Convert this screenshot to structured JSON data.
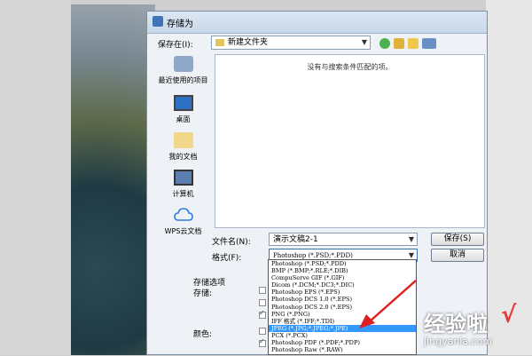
{
  "dialog": {
    "title": "存储为",
    "save_in_label": "保存在(I):",
    "current_folder": "新建文件夹",
    "empty_message": "没有与搜索条件匹配的项。"
  },
  "places": [
    {
      "label": "最近使用的项目",
      "icon": "recent-items-icon"
    },
    {
      "label": "桌面",
      "icon": "desktop-icon"
    },
    {
      "label": "我的文档",
      "icon": "documents-icon"
    },
    {
      "label": "计算机",
      "icon": "computer-icon"
    },
    {
      "label": "WPS云文档",
      "icon": "cloud-icon"
    }
  ],
  "filename": {
    "label": "文件名(N):",
    "value": "演示文稿2-1"
  },
  "format": {
    "label": "格式(F):",
    "value": "Photoshop (*.PSD;*.PDD)",
    "options": [
      "Photoshop (*.PSD;*.PDD)",
      "BMP (*.BMP;*.RLE;*.DIB)",
      "CompuServe GIF (*.GIF)",
      "Dicom (*.DCM;*.DC3;*.DIC)",
      "Photoshop EPS (*.EPS)",
      "Photoshop DCS 1.0 (*.EPS)",
      "Photoshop DCS 2.0 (*.EPS)",
      "PNG (*.PNG)",
      "IFF 格式 (*.IFF;*.TDI)",
      "JPEG (*.JPG;*.JPEG;*.JPE)",
      "PCX (*.PCX)",
      "Photoshop PDF (*.PDF;*.PDP)",
      "Photoshop Raw (*.RAW)"
    ],
    "selected_index": 9
  },
  "buttons": {
    "save": "保存(S)",
    "cancel": "取消"
  },
  "options_section": {
    "title": "存储选项",
    "store_label": "存储:",
    "color_label": "颜色:"
  },
  "watermark": {
    "text": "经验啦",
    "mark": "√",
    "url": "jingyanla.com"
  },
  "colors": {
    "selection": "#3399ff",
    "arrow": "#e02020"
  }
}
